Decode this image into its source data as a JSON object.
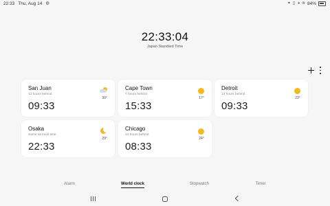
{
  "status_bar": {
    "time": "22:33",
    "date": "Thu, Aug 14",
    "battery": "84%"
  },
  "main_clock": {
    "time": "22:33:04",
    "timezone": "Japan Standard Time"
  },
  "world_clocks": [
    {
      "city": "San Juan",
      "difference": "13 hours behind",
      "time": "09:33",
      "temperature": "30°",
      "weather_icon": "partly-sunny-icon"
    },
    {
      "city": "Cape Town",
      "difference": "7 hours behind",
      "time": "15:33",
      "temperature": "17°",
      "weather_icon": "sunny-icon"
    },
    {
      "city": "Detroit",
      "difference": "13 hours behind",
      "time": "09:33",
      "temperature": "23°",
      "weather_icon": "sunny-icon"
    },
    {
      "city": "Osaka",
      "difference": "Same as local time",
      "time": "22:33",
      "temperature": "29°",
      "weather_icon": "clear-night-icon"
    },
    {
      "city": "Chicago",
      "difference": "14 hours behind",
      "time": "08:33",
      "temperature": "24°",
      "weather_icon": "sunny-icon"
    }
  ],
  "tabs": {
    "alarm": "Alarm",
    "world_clock": "World clock",
    "stopwatch": "Stopwatch",
    "timer": "Timer",
    "active": "world_clock"
  },
  "colors": {
    "background": "#f6f6f6",
    "card": "#ffffff",
    "sun": "#f6b81f"
  }
}
